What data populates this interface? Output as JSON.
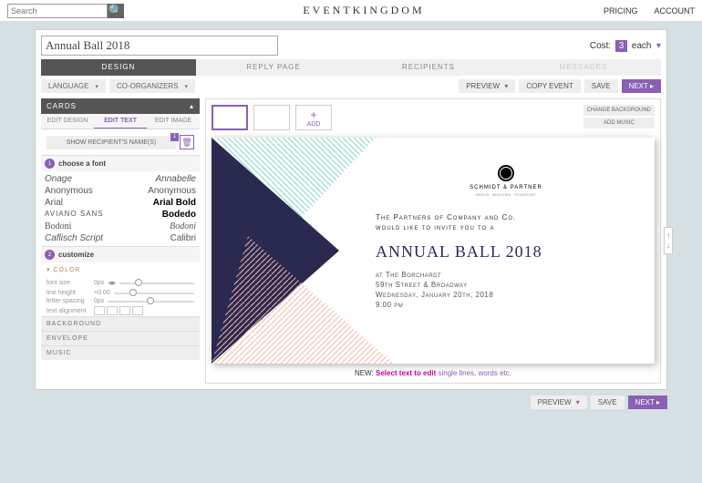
{
  "top": {
    "search_ph": "Search",
    "brand": "EVENTKINGDOM",
    "nav": [
      "PRICING",
      "ACCOUNT"
    ]
  },
  "header": {
    "title": "Annual Ball 2018",
    "cost_label": "Cost:",
    "cost_n": "3",
    "cost_unit": "each"
  },
  "tabs": [
    "DESIGN",
    "REPLY PAGE",
    "RECIPIENTS",
    "MESSAGES"
  ],
  "dropdowns": {
    "lang": "LANGUAGE",
    "co": "CO-ORGANIZERS"
  },
  "actions": {
    "preview": "PREVIEW",
    "copy": "COPY EVENT",
    "save": "SAVE",
    "next": "NEXT"
  },
  "left": {
    "cards": "CARDS",
    "edit_tabs": [
      "EDIT DESIGN",
      "EDIT TEXT",
      "EDIT IMAGE"
    ],
    "show": "SHOW RECIPIENT'S NAME(S)",
    "show_badge": "1",
    "choose": "choose a font",
    "fonts": [
      [
        "Onage",
        "Annabelle"
      ],
      [
        "Anonymous",
        "Anonymous"
      ],
      [
        "Arial",
        "Arial Bold"
      ],
      [
        "AVIANO SANS",
        "Bodedo"
      ],
      [
        "Bodoni",
        "Bodoni"
      ],
      [
        "Caflisch Script",
        "Calibri"
      ]
    ],
    "customize": "customize",
    "color": "COLOR",
    "ctrls": [
      [
        "font size",
        "0px"
      ],
      [
        "line height",
        "+0.00"
      ],
      [
        "letter spacing",
        "0px"
      ],
      [
        "text alignment",
        ""
      ]
    ],
    "acc": [
      "BACKGROUND",
      "ENVELOPE",
      "MUSIC"
    ]
  },
  "right": {
    "add": "ADD",
    "change_bg": "CHANGE BACKGROUND",
    "add_music": "ADD MUSIC",
    "new": "NEW:",
    "new_b": "Select text to edit",
    "new_rest": "single lines, words etc."
  },
  "card": {
    "logo": "SCHMIDT & PARTNER",
    "logo_sub": "BERLIN · MÜNCHEN · FRANKFURT",
    "l1": "The Partners of Company and Co.",
    "l2": "would like to invite you to a",
    "title": "ANNUAL BALL 2018",
    "d1": "at The Borchardt",
    "d2": "59th Street & Broadway",
    "d3": "Wednesday, January 20th, 2018",
    "d4": "9:00 pm"
  }
}
